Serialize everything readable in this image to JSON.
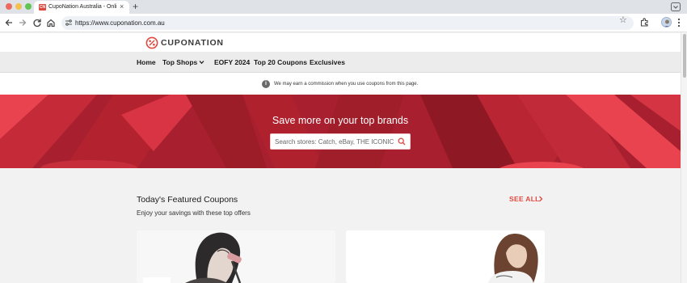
{
  "browser": {
    "tab_title": "CupoNation Australia - Online",
    "tab_favicon_text": "CN",
    "tab_close": "×",
    "new_tab": "+",
    "url": "https://www.cuponation.com.au",
    "bookmark_star": "☆"
  },
  "site": {
    "logo_text": "CUPONATION",
    "brand_color": "#e0483e"
  },
  "nav": {
    "home": "Home",
    "top_shops": "Top Shops",
    "eofy": "EOFY 2024",
    "top20": "Top 20 Coupons",
    "exclusives": "Exclusives"
  },
  "notice": {
    "icon": "i",
    "text": "We may earn a commission when you use coupons from this page."
  },
  "hero": {
    "title": "Save more on your top brands",
    "search_placeholder": "Search stores: Catch, eBay, THE ICONIC, ..."
  },
  "featured": {
    "title": "Today's Featured Coupons",
    "subtitle": "Enjoy your savings with these top offers",
    "see_all": "SEE ALL"
  },
  "icons": [
    "back-arrow-icon",
    "forward-arrow-icon",
    "reload-icon",
    "home-icon",
    "site-settings-icon",
    "star-icon",
    "extensions-icon",
    "profile-avatar-icon",
    "menu-icon",
    "info-icon",
    "search-icon",
    "chevron-down-icon",
    "chevron-right-icon"
  ]
}
